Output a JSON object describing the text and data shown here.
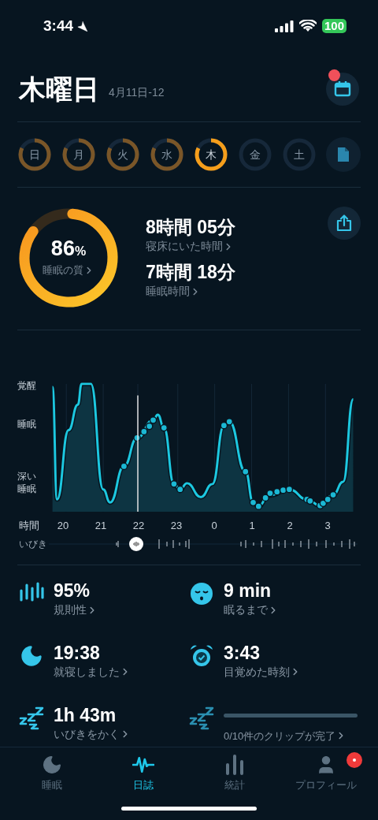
{
  "status_bar": {
    "time": "3:44",
    "battery": "100"
  },
  "header": {
    "title": "木曜日",
    "date": "4月11日-12",
    "calendar_notification": true
  },
  "days": [
    {
      "label": "日",
      "recorded": true,
      "selected": false
    },
    {
      "label": "月",
      "recorded": true,
      "selected": false
    },
    {
      "label": "火",
      "recorded": true,
      "selected": false
    },
    {
      "label": "水",
      "recorded": true,
      "selected": false
    },
    {
      "label": "木",
      "recorded": true,
      "selected": true
    },
    {
      "label": "金",
      "recorded": false,
      "selected": false
    },
    {
      "label": "土",
      "recorded": false,
      "selected": false
    }
  ],
  "summary": {
    "quality": {
      "value": "86",
      "unit": "%",
      "label": "睡眠の質"
    },
    "times": [
      {
        "value": "8時間 05分",
        "label": "寝床にいた時間"
      },
      {
        "value": "7時間 18分",
        "label": "睡眠時間"
      }
    ]
  },
  "chart": {
    "stages": [
      "覚醒",
      "睡眠",
      "深い睡眠"
    ],
    "time_label": "時間",
    "hours": [
      "20",
      "21",
      "22",
      "23",
      "0",
      "1",
      "2",
      "3"
    ],
    "snore_label": "いびき"
  },
  "stats": [
    {
      "kind": "regularity",
      "value": "95%",
      "label": "規則性"
    },
    {
      "kind": "onset",
      "value": "9 min",
      "label": "眠るまで"
    },
    {
      "kind": "bedtime",
      "value": "19:38",
      "label": "就寝しました"
    },
    {
      "kind": "wakeup",
      "value": "3:43",
      "label": "目覚めた時刻"
    },
    {
      "kind": "snore",
      "value": "1h 43m",
      "label": "いびきをかく"
    },
    {
      "kind": "clips",
      "label": "0/10件のクリップが完了"
    }
  ],
  "tabs": [
    {
      "kind": "sleep",
      "label": "睡眠",
      "selected": false,
      "notification": false
    },
    {
      "kind": "journal",
      "label": "日誌",
      "selected": true,
      "notification": false
    },
    {
      "kind": "stats",
      "label": "統計",
      "selected": false,
      "notification": false
    },
    {
      "kind": "profile",
      "label": "プロフィール",
      "selected": false,
      "notification": true
    }
  ]
}
